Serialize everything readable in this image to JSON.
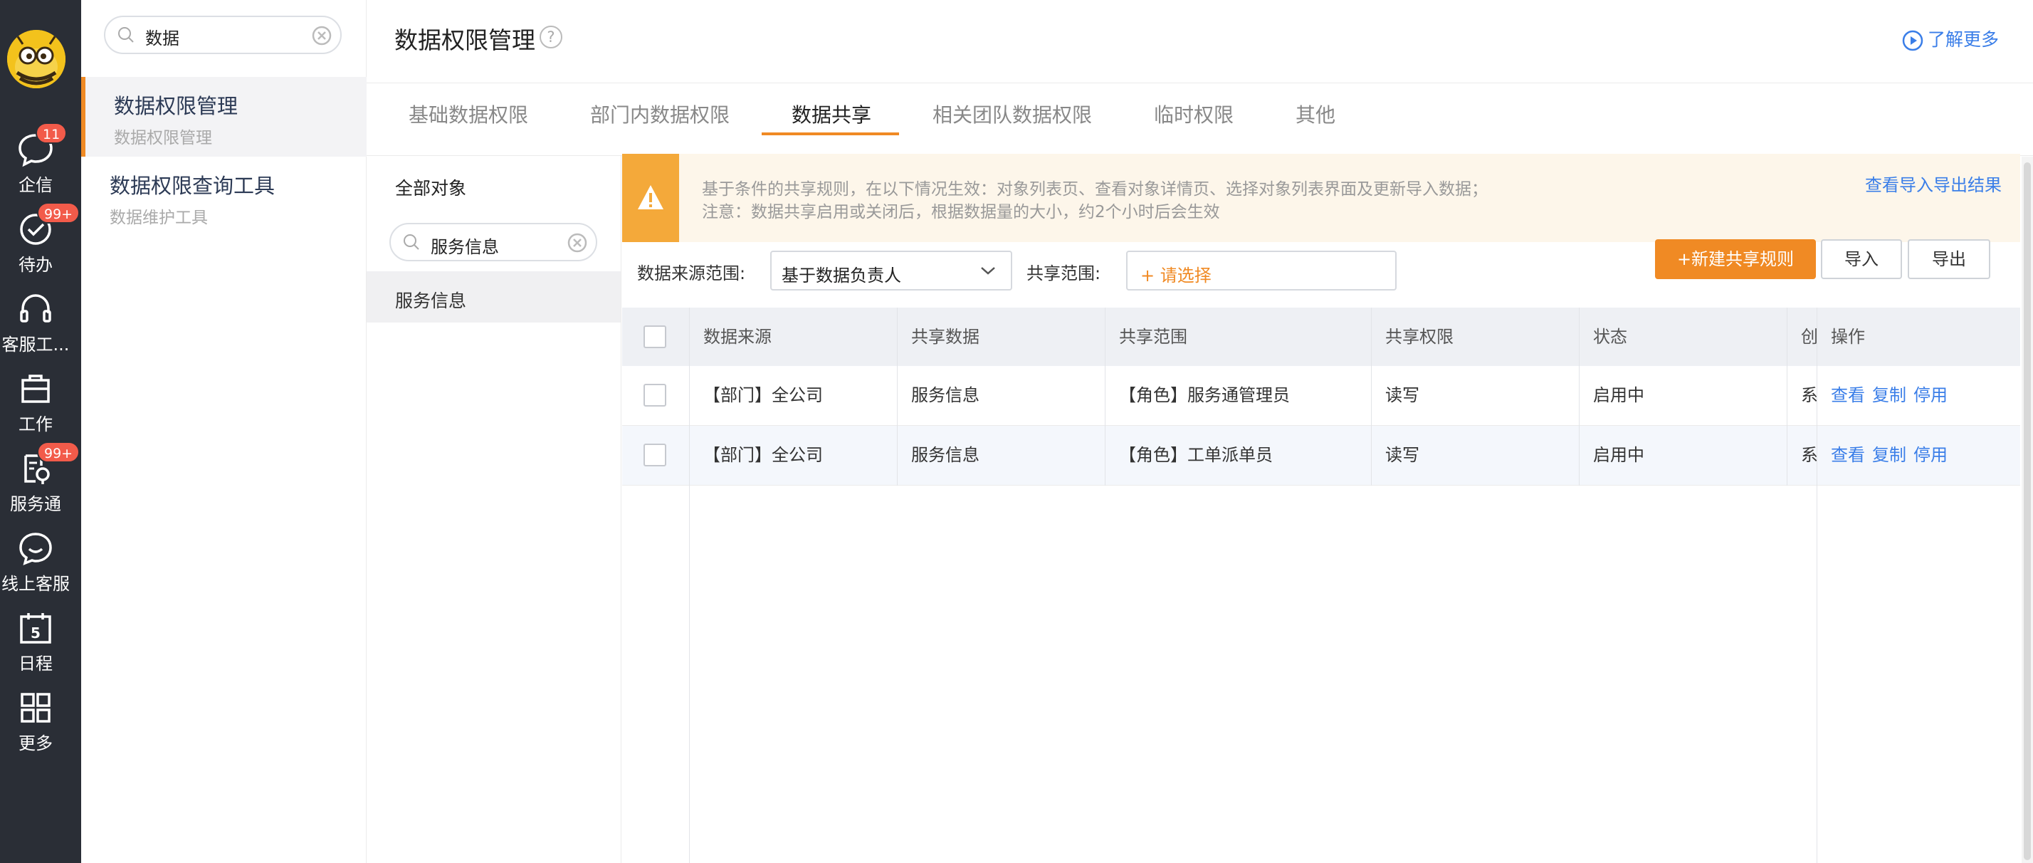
{
  "rail": {
    "items": [
      {
        "label": "企信",
        "icon": "chat-bubble-icon",
        "badge": "11"
      },
      {
        "label": "待办",
        "icon": "check-circle-icon",
        "badge": "99+"
      },
      {
        "label": "客服工...",
        "icon": "headset-icon",
        "badge": ""
      },
      {
        "label": "工作",
        "icon": "briefcase-icon",
        "badge": ""
      },
      {
        "label": "服务通",
        "icon": "service-tool-icon",
        "badge": "99+"
      },
      {
        "label": "线上客服",
        "icon": "smile-chat-icon",
        "badge": ""
      },
      {
        "label": "日程",
        "icon": "calendar-icon",
        "badge": "",
        "calendar_day": "5"
      },
      {
        "label": "更多",
        "icon": "grid-icon",
        "badge": ""
      }
    ]
  },
  "sidebar": {
    "search_value": "数据",
    "items": [
      {
        "title": "数据权限管理",
        "subtitle": "数据权限管理"
      },
      {
        "title": "数据权限查询工具",
        "subtitle": "数据维护工具"
      }
    ]
  },
  "header": {
    "title": "数据权限管理",
    "help": "?",
    "learn_more": "了解更多"
  },
  "tabs": [
    "基础数据权限",
    "部门内数据权限",
    "数据共享",
    "相关团队数据权限",
    "临时权限",
    "其他"
  ],
  "objects": {
    "all_label": "全部对象",
    "search_value": "服务信息",
    "items": [
      "服务信息"
    ]
  },
  "notice": {
    "line1": "基于条件的共享规则，在以下情况生效：对象列表页、查看对象详情页、选择对象列表界面及更新导入数据；",
    "line2": "注意：数据共享启用或关闭后，根据数据量的大小，约2个小时后会生效",
    "link": "查看导入导出结果"
  },
  "filters": {
    "source_label": "数据来源范围:",
    "source_value": "基于数据负责人",
    "scope_label": "共享范围:",
    "scope_placeholder": "+ 请选择"
  },
  "buttons": {
    "new_rule": "+新建共享规则",
    "import": "导入",
    "export": "导出"
  },
  "table": {
    "headers": [
      "数据来源",
      "共享数据",
      "共享范围",
      "共享权限",
      "状态",
      "创",
      "操作"
    ],
    "rows": [
      {
        "source": "【部门】全公司",
        "data": "服务信息",
        "scope": "【角色】服务通管理员",
        "permission": "读写",
        "status": "启用中",
        "creator": "系"
      },
      {
        "source": "【部门】全公司",
        "data": "服务信息",
        "scope": "【角色】工单派单员",
        "permission": "读写",
        "status": "启用中",
        "creator": "系"
      }
    ],
    "actions": [
      "查看",
      "复制",
      "停用"
    ]
  },
  "colors": {
    "accent": "#f08a24",
    "link": "#3a7ee8",
    "rail_bg": "#2a2e36",
    "warning": "#f4a93a",
    "badge": "#f25b4a"
  }
}
